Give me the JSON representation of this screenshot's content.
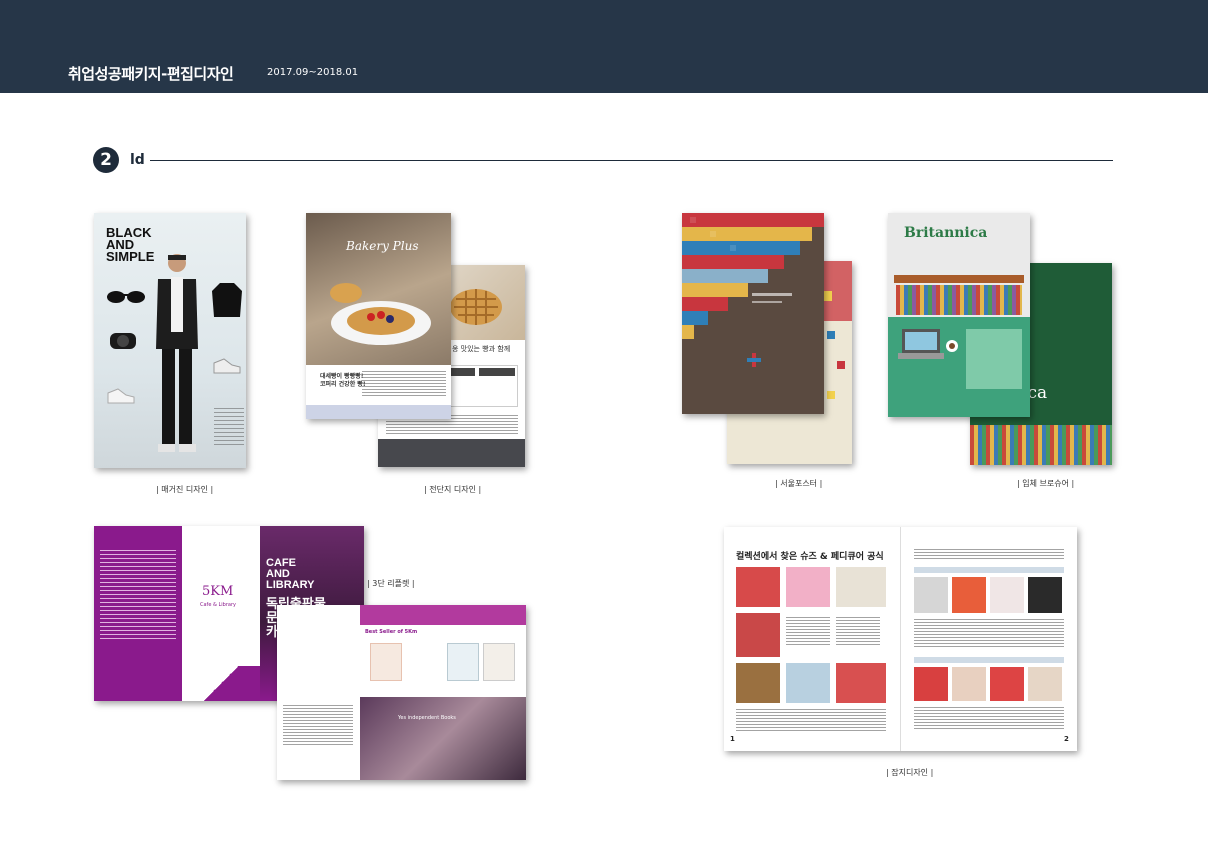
{
  "header": {
    "title": "취업성공패키지-편집디자인",
    "date": "2017.09~2018.01"
  },
  "section": {
    "number": "2",
    "label": "ld"
  },
  "captions": {
    "fashion": "| 매거진 디자인 |",
    "bakery": "| 전단지 디자인 |",
    "seoul": "| 서울포스터 |",
    "britannica": "| 입체 브로슈어 |",
    "brochure": "| 3단 리플렛 |",
    "magazine": "| 잡지디자인 |"
  },
  "fashion": {
    "headline_1": "BLACK",
    "headline_2": "AND",
    "headline_3": "SIMPLE"
  },
  "bakery": {
    "logo": "Bakery Plus",
    "panel_text": "대세빵이 빵빵빵!\n코퍼리 건강한 빵!",
    "back_text": "옹 맛있는 빵과 함께"
  },
  "britannica": {
    "logo_front": "Britannica",
    "logo_back": "annica"
  },
  "cafe": {
    "title_1": "CAFE",
    "title_2": "AND",
    "title_3": "LIBRARY",
    "subtitle_1": "독립출판물",
    "subtitle_2": "문화공간",
    "subtitle_3": "카페",
    "logo": "5KM",
    "logo_sub": "Cafe & Library",
    "best_seller": "Best Seller of 5Km",
    "indie": "Yes independent Books"
  },
  "magazine": {
    "title": "컬렉션에서 찾은 슈즈 & 페디큐어 공식",
    "page_left": "1",
    "page_right": "2"
  },
  "colors": {
    "header_bg": "#263648",
    "accent_purple": "#8a1a8c"
  }
}
